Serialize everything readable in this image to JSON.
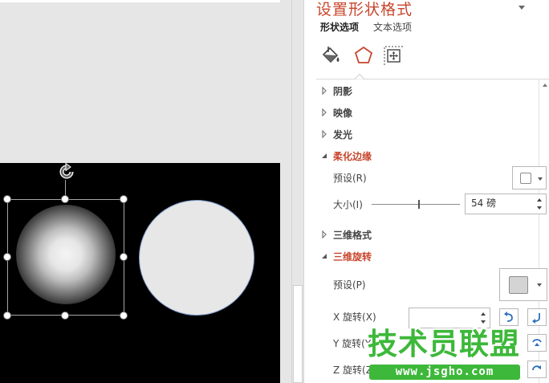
{
  "pane": {
    "title": "设置形状格式",
    "tabs": [
      {
        "label": "形状选项",
        "active": true
      },
      {
        "label": "文本选项",
        "active": false
      }
    ],
    "icon_tabs": [
      "fill-line-icon",
      "effects-pentagon-icon",
      "size-properties-icon"
    ],
    "sections": {
      "shadow": "阴影",
      "reflection": "映像",
      "glow": "发光",
      "soft_edges": "柔化边缘",
      "format_3d": "三维格式",
      "rotation_3d": "三维旋转"
    },
    "soft_edges": {
      "preset_label": "预设(R)",
      "size_label": "大小(I)",
      "size_value": "54 磅",
      "slider_fraction": 0.53
    },
    "rotation_3d": {
      "preset_label": "预设(P)",
      "x_label": "X 旋转(X)",
      "y_label": "Y 旋转(Y)",
      "z_label": "Z 旋转(Z)",
      "x_value": "",
      "y_value": "",
      "z_value": ""
    }
  },
  "watermark": {
    "text": "技术员联盟",
    "url": "www.jsgho.com"
  },
  "colors": {
    "accent": "#c8462d",
    "slide_bg": "#000000",
    "circle_fill": "#e7e7e7",
    "circle_outline": "#7f9ccc",
    "rot_button_blue": "#2e6fba",
    "watermark_green": "#3db83a"
  }
}
